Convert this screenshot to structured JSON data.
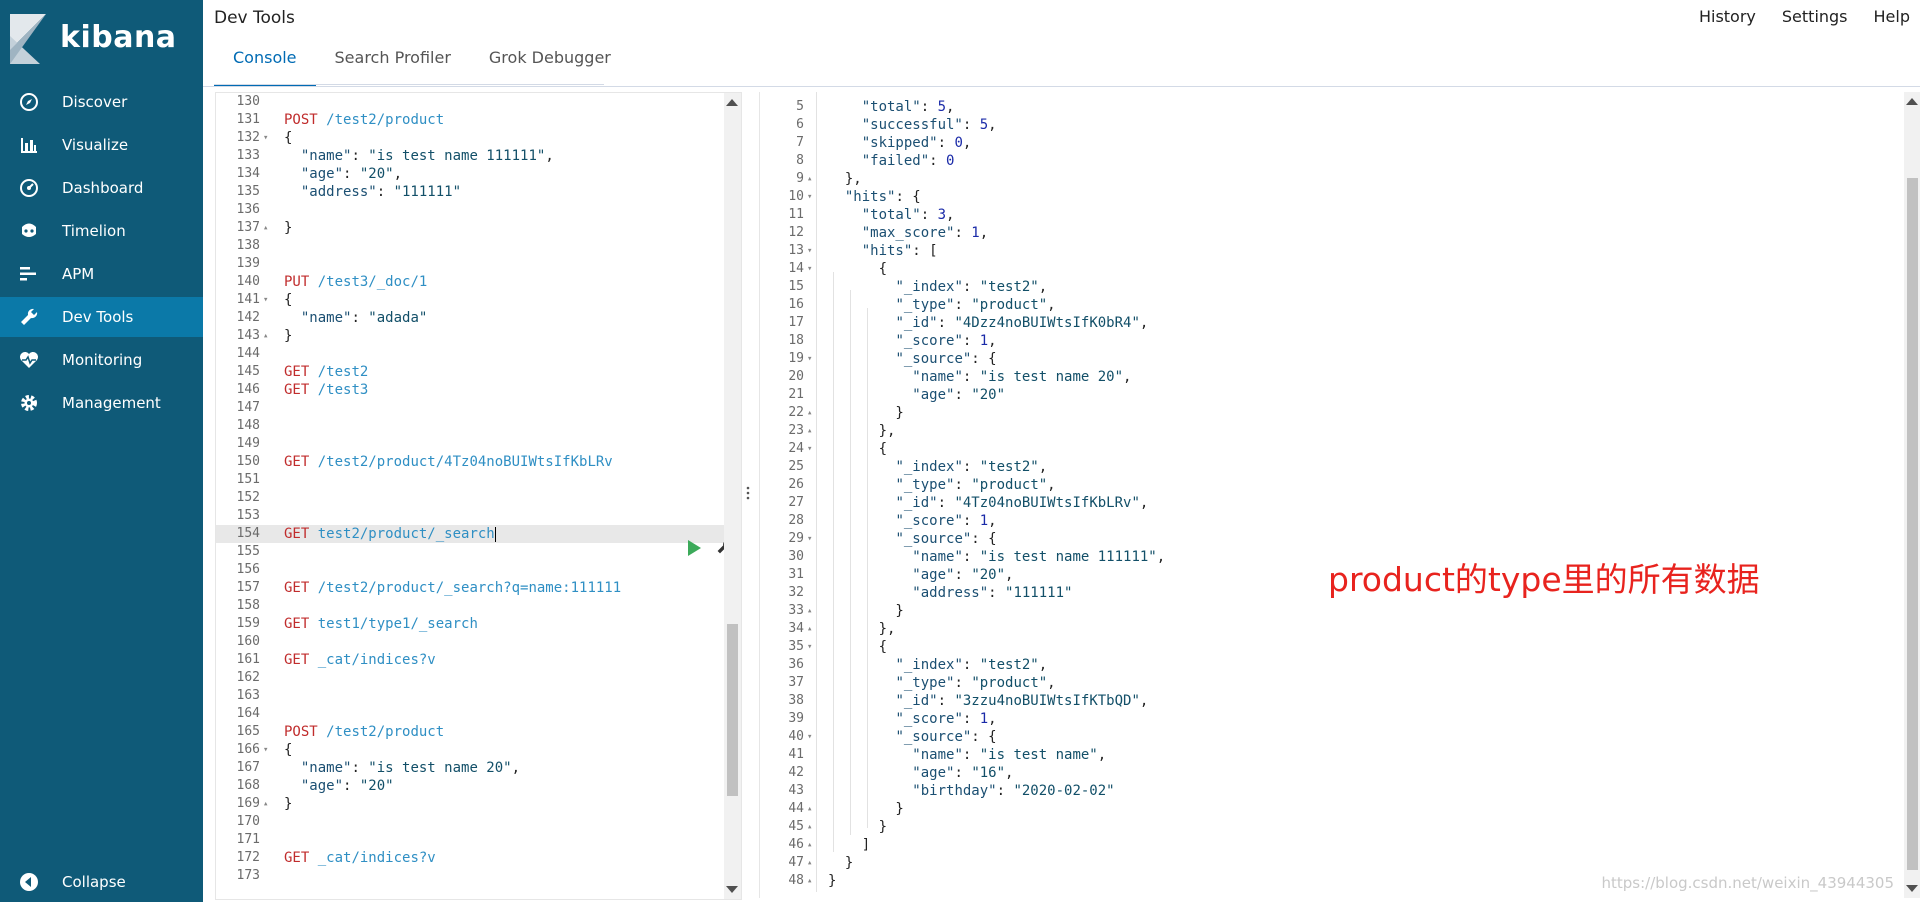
{
  "brand": {
    "name": "kibana"
  },
  "sidebar": {
    "items": [
      {
        "label": "Discover",
        "icon": "compass-icon"
      },
      {
        "label": "Visualize",
        "icon": "bar-chart-icon"
      },
      {
        "label": "Dashboard",
        "icon": "dashboard-icon"
      },
      {
        "label": "Timelion",
        "icon": "timelion-icon"
      },
      {
        "label": "APM",
        "icon": "apm-icon"
      },
      {
        "label": "Dev Tools",
        "icon": "wrench-icon",
        "active": true
      },
      {
        "label": "Monitoring",
        "icon": "heartbeat-icon"
      },
      {
        "label": "Management",
        "icon": "gear-icon"
      }
    ],
    "collapse_label": "Collapse"
  },
  "header": {
    "title": "Dev Tools",
    "links": [
      "History",
      "Settings",
      "Help"
    ],
    "tabs": [
      {
        "label": "Console",
        "active": true
      },
      {
        "label": "Search Profiler",
        "active": false
      },
      {
        "label": "Grok Debugger",
        "active": false
      }
    ]
  },
  "editor": {
    "lines": [
      {
        "n": "130",
        "f": "",
        "t": ""
      },
      {
        "n": "131",
        "f": "",
        "t": "POST /test2/product"
      },
      {
        "n": "132",
        "f": "▾",
        "t": "{"
      },
      {
        "n": "133",
        "f": "",
        "t": "  \"name\": \"is test name 111111\","
      },
      {
        "n": "134",
        "f": "",
        "t": "  \"age\": \"20\","
      },
      {
        "n": "135",
        "f": "",
        "t": "  \"address\": \"111111\""
      },
      {
        "n": "136",
        "f": "",
        "t": ""
      },
      {
        "n": "137",
        "f": "▴",
        "t": "}"
      },
      {
        "n": "138",
        "f": "",
        "t": ""
      },
      {
        "n": "139",
        "f": "",
        "t": ""
      },
      {
        "n": "140",
        "f": "",
        "t": "PUT /test3/_doc/1"
      },
      {
        "n": "141",
        "f": "▾",
        "t": "{"
      },
      {
        "n": "142",
        "f": "",
        "t": "  \"name\": \"adada\""
      },
      {
        "n": "143",
        "f": "▴",
        "t": "}"
      },
      {
        "n": "144",
        "f": "",
        "t": ""
      },
      {
        "n": "145",
        "f": "",
        "t": "GET /test2"
      },
      {
        "n": "146",
        "f": "",
        "t": "GET /test3"
      },
      {
        "n": "147",
        "f": "",
        "t": ""
      },
      {
        "n": "148",
        "f": "",
        "t": ""
      },
      {
        "n": "149",
        "f": "",
        "t": ""
      },
      {
        "n": "150",
        "f": "",
        "t": "GET /test2/product/4Tz04noBUIWtsIfKbLRv"
      },
      {
        "n": "151",
        "f": "",
        "t": ""
      },
      {
        "n": "152",
        "f": "",
        "t": ""
      },
      {
        "n": "153",
        "f": "",
        "t": ""
      },
      {
        "n": "154",
        "f": "",
        "t": "GET test2/product/_search",
        "active": true
      },
      {
        "n": "155",
        "f": "",
        "t": ""
      },
      {
        "n": "156",
        "f": "",
        "t": ""
      },
      {
        "n": "157",
        "f": "",
        "t": "GET /test2/product/_search?q=name:111111"
      },
      {
        "n": "158",
        "f": "",
        "t": ""
      },
      {
        "n": "159",
        "f": "",
        "t": "GET test1/type1/_search"
      },
      {
        "n": "160",
        "f": "",
        "t": ""
      },
      {
        "n": "161",
        "f": "",
        "t": "GET _cat/indices?v"
      },
      {
        "n": "162",
        "f": "",
        "t": ""
      },
      {
        "n": "163",
        "f": "",
        "t": ""
      },
      {
        "n": "164",
        "f": "",
        "t": ""
      },
      {
        "n": "165",
        "f": "",
        "t": "POST /test2/product"
      },
      {
        "n": "166",
        "f": "▾",
        "t": "{"
      },
      {
        "n": "167",
        "f": "",
        "t": "  \"name\": \"is test name 20\","
      },
      {
        "n": "168",
        "f": "",
        "t": "  \"age\": \"20\""
      },
      {
        "n": "169",
        "f": "▴",
        "t": "}"
      },
      {
        "n": "170",
        "f": "",
        "t": ""
      },
      {
        "n": "171",
        "f": "",
        "t": ""
      },
      {
        "n": "172",
        "f": "",
        "t": "GET _cat/indices?v"
      },
      {
        "n": "173",
        "f": "",
        "t": ""
      }
    ]
  },
  "output": {
    "lines": [
      {
        "n": "5",
        "f": "",
        "t": "    \"total\": 5,"
      },
      {
        "n": "6",
        "f": "",
        "t": "    \"successful\": 5,"
      },
      {
        "n": "7",
        "f": "",
        "t": "    \"skipped\": 0,"
      },
      {
        "n": "8",
        "f": "",
        "t": "    \"failed\": 0"
      },
      {
        "n": "9",
        "f": "▴",
        "t": "  },"
      },
      {
        "n": "10",
        "f": "▾",
        "t": "  \"hits\": {"
      },
      {
        "n": "11",
        "f": "",
        "t": "    \"total\": 3,"
      },
      {
        "n": "12",
        "f": "",
        "t": "    \"max_score\": 1,"
      },
      {
        "n": "13",
        "f": "▾",
        "t": "    \"hits\": ["
      },
      {
        "n": "14",
        "f": "▾",
        "t": "      {"
      },
      {
        "n": "15",
        "f": "",
        "t": "        \"_index\": \"test2\","
      },
      {
        "n": "16",
        "f": "",
        "t": "        \"_type\": \"product\","
      },
      {
        "n": "17",
        "f": "",
        "t": "        \"_id\": \"4Dzz4noBUIWtsIfK0bR4\","
      },
      {
        "n": "18",
        "f": "",
        "t": "        \"_score\": 1,"
      },
      {
        "n": "19",
        "f": "▾",
        "t": "        \"_source\": {"
      },
      {
        "n": "20",
        "f": "",
        "t": "          \"name\": \"is test name 20\","
      },
      {
        "n": "21",
        "f": "",
        "t": "          \"age\": \"20\""
      },
      {
        "n": "22",
        "f": "▴",
        "t": "        }"
      },
      {
        "n": "23",
        "f": "▴",
        "t": "      },"
      },
      {
        "n": "24",
        "f": "▾",
        "t": "      {"
      },
      {
        "n": "25",
        "f": "",
        "t": "        \"_index\": \"test2\","
      },
      {
        "n": "26",
        "f": "",
        "t": "        \"_type\": \"product\","
      },
      {
        "n": "27",
        "f": "",
        "t": "        \"_id\": \"4Tz04noBUIWtsIfKbLRv\","
      },
      {
        "n": "28",
        "f": "",
        "t": "        \"_score\": 1,"
      },
      {
        "n": "29",
        "f": "▾",
        "t": "        \"_source\": {"
      },
      {
        "n": "30",
        "f": "",
        "t": "          \"name\": \"is test name 111111\","
      },
      {
        "n": "31",
        "f": "",
        "t": "          \"age\": \"20\","
      },
      {
        "n": "32",
        "f": "",
        "t": "          \"address\": \"111111\""
      },
      {
        "n": "33",
        "f": "▴",
        "t": "        }"
      },
      {
        "n": "34",
        "f": "▴",
        "t": "      },"
      },
      {
        "n": "35",
        "f": "▾",
        "t": "      {"
      },
      {
        "n": "36",
        "f": "",
        "t": "        \"_index\": \"test2\","
      },
      {
        "n": "37",
        "f": "",
        "t": "        \"_type\": \"product\","
      },
      {
        "n": "38",
        "f": "",
        "t": "        \"_id\": \"3zzu4noBUIWtsIfKTbQD\","
      },
      {
        "n": "39",
        "f": "",
        "t": "        \"_score\": 1,"
      },
      {
        "n": "40",
        "f": "▾",
        "t": "        \"_source\": {"
      },
      {
        "n": "41",
        "f": "",
        "t": "          \"name\": \"is test name\","
      },
      {
        "n": "42",
        "f": "",
        "t": "          \"age\": \"16\","
      },
      {
        "n": "43",
        "f": "",
        "t": "          \"birthday\": \"2020-02-02\""
      },
      {
        "n": "44",
        "f": "▴",
        "t": "        }"
      },
      {
        "n": "45",
        "f": "▴",
        "t": "      }"
      },
      {
        "n": "46",
        "f": "▴",
        "t": "    ]"
      },
      {
        "n": "47",
        "f": "▴",
        "t": "  }"
      },
      {
        "n": "48",
        "f": "▴",
        "t": "}"
      }
    ]
  },
  "annotation": {
    "text": "product的type里的所有数据"
  },
  "watermark": {
    "text": "https://blog.csdn.net/weixin_43944305"
  },
  "colors": {
    "sidebar_bg": "#0f5a78",
    "sidebar_active": "#0b79a8",
    "tab_active": "#006bb4",
    "method": "#c02c2c",
    "url": "#2f8fc4",
    "annotation": "#e8231e",
    "run": "#3caa5a"
  }
}
